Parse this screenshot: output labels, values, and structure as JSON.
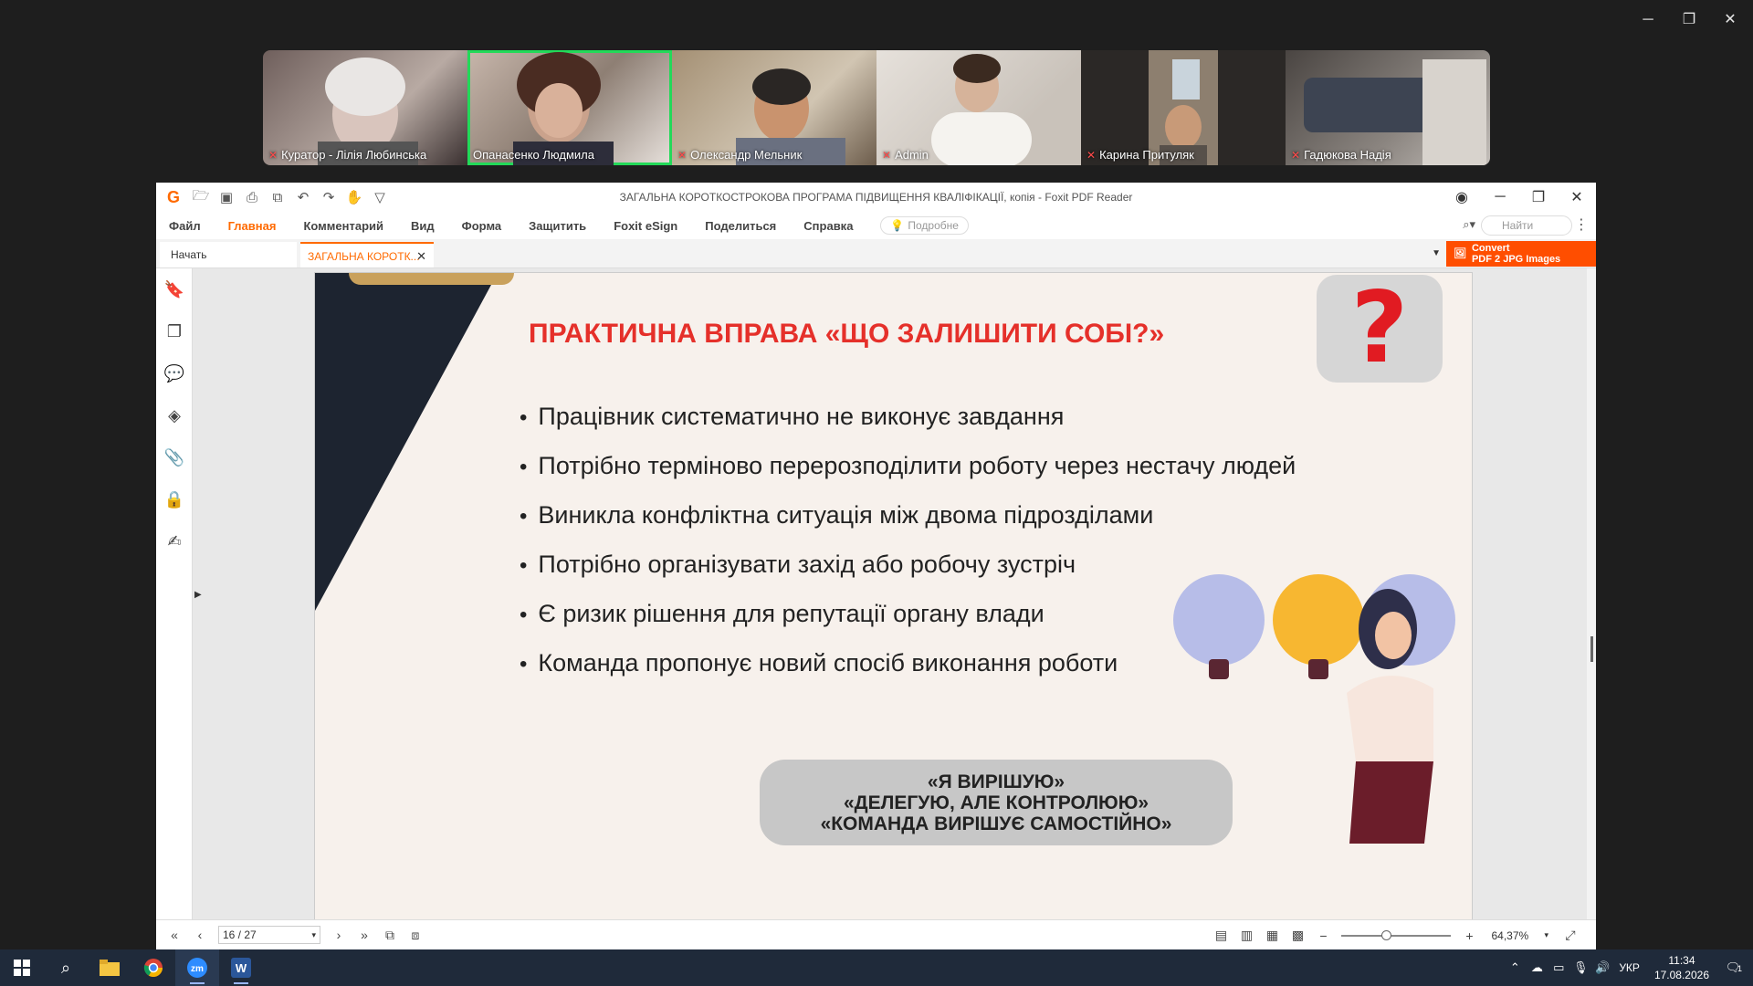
{
  "participants": [
    {
      "name": "Куратор - Лілія Любинська",
      "muted": true,
      "active": false,
      "bg": "#8f7d78"
    },
    {
      "name": "Опанасенко Людмила",
      "muted": false,
      "active": true,
      "bg": "#b9a9a0"
    },
    {
      "name": "Олександр Мельник",
      "muted": true,
      "active": false,
      "bg": "#9d8f7c"
    },
    {
      "name": "Admin",
      "muted": true,
      "active": false,
      "bg": "#d9d4ce"
    },
    {
      "name": "Карина Притуляк",
      "muted": true,
      "active": false,
      "bg": "#4a4540"
    },
    {
      "name": "Гадюкова Надія",
      "muted": true,
      "active": false,
      "bg": "#7c7671"
    }
  ],
  "window": {
    "title": "ЗАГАЛЬНА КОРОТКОСТРОКОВА ПРОГРАМА ПІДВИЩЕННЯ КВАЛІФІКАЦІЇ, копія - Foxit PDF Reader"
  },
  "menu": {
    "items": [
      "Файл",
      "Главная",
      "Комментарий",
      "Вид",
      "Форма",
      "Защитить",
      "Foxit eSign",
      "Поделиться",
      "Справка"
    ],
    "active_index": 1,
    "search_hint": "Подробне",
    "find_placeholder": "Найти"
  },
  "tabs": {
    "start": "Начать",
    "doc": "ЗАГАЛЬНА КОРОТК..."
  },
  "convert": {
    "line1": "Convert",
    "line2": "PDF 2 JPG Images"
  },
  "slide": {
    "title": "ПРАКТИЧНА ВПРАВА «ЩО ЗАЛИШИТИ СОБІ?»",
    "qmark": "?",
    "bullets": [
      "Працівник систематично не виконує завдання",
      "Потрібно терміново перерозподілити роботу через нестачу людей",
      "Виникла конфліктна ситуація між двома підрозділами",
      "Потрібно організувати захід або робочу зустріч",
      "Є ризик рішення для репутації органу влади",
      "Команда пропонує новий спосіб виконання роботи"
    ],
    "pill": [
      "«Я ВИРІШУЮ»",
      "«ДЕЛЕГУЮ, АЛЕ КОНТРОЛЮЮ»",
      "«КОМАНДА ВИРІШУЄ САМОСТІЙНО»"
    ]
  },
  "status": {
    "page": "16 / 27",
    "page_fraction": 0.5926,
    "zoom": "64,37%"
  },
  "taskbar": {
    "lang": "УКР",
    "time": "11:34",
    "date": "17.08.2026",
    "notifications": "1"
  },
  "colors": {
    "accent": "#ff6a00",
    "title_red": "#e5302a",
    "active_speaker": "#23d959"
  }
}
